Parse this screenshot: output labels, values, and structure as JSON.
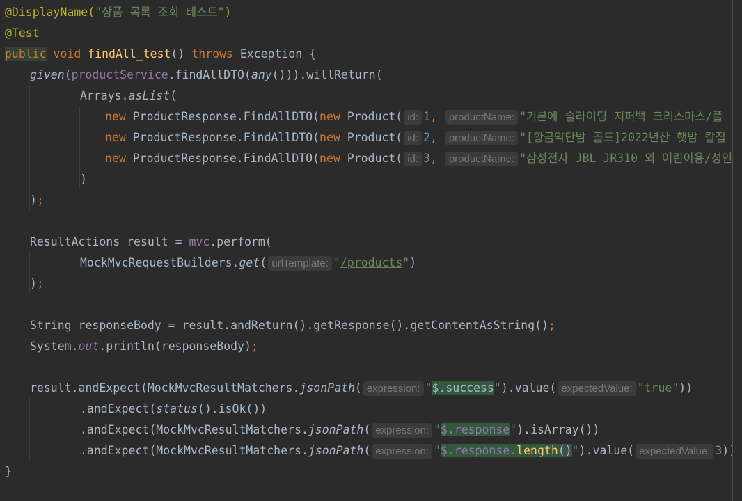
{
  "code": {
    "l1": {
      "annotation": "@DisplayName(",
      "string": "\"상품 목록 조회 테스트\"",
      "close": ")"
    },
    "l2": {
      "annotation": "@Test"
    },
    "l3": {
      "public": "public",
      "void": "void",
      "method": "findAll_test",
      "params": "()",
      "throws": "throws",
      "rest": "Exception {"
    },
    "l4": {
      "given": "given",
      "p1": "(",
      "service": "productService",
      "call": ".findAllDTO(",
      "any": "any",
      "rest": "())).willReturn("
    },
    "l5": {
      "text": "Arrays.",
      "aslist": "asList",
      "paren": "("
    },
    "rows": [
      {
        "new1": "new",
        "cls": " ProductResponse.FindAllDTO(",
        "new2": "new",
        "product": " Product(",
        "id_hint": "id:",
        "id": "1",
        "comma": ",",
        "name_hint": "productName:",
        "name": "\"기본에 슬라이딩 지퍼백 크리스마스/플"
      },
      {
        "new1": "new",
        "cls": " ProductResponse.FindAllDTO(",
        "new2": "new",
        "product": " Product(",
        "id_hint": "id:",
        "id": "2",
        "comma": ",",
        "name_hint": "productName:",
        "name": "\"[황금약단밤 골드]2022년산 햇밤 칼집"
      },
      {
        "new1": "new",
        "cls": " ProductResponse.FindAllDTO(",
        "new2": "new",
        "product": " Product(",
        "id_hint": "id:",
        "id": "3",
        "comma": ",",
        "name_hint": "productName:",
        "name": "\"삼성전자 JBL JR310 외 어린이용/성인"
      }
    ],
    "l9": {
      "text": ")"
    },
    "l10": {
      "paren": ")",
      "semi": ";"
    },
    "l12": {
      "text": "ResultActions result = ",
      "mvc": "mvc",
      "rest": ".perform("
    },
    "l13": {
      "text": "MockMvcRequestBuilders.",
      "get": "get",
      "paren": "(",
      "hint": "urlTemplate:",
      "q1": "\"",
      "url": "/products",
      "q2": "\"",
      "close": ")"
    },
    "l14": {
      "paren": ")",
      "semi": ";"
    },
    "l16": {
      "text": "String responseBody = result.andReturn().getResponse().getContentAsString()",
      "semi": ";"
    },
    "l17": {
      "text": "System.",
      "out": "out",
      "rest": ".println(responseBody)",
      "semi": ";"
    },
    "l19": {
      "text": "result.andExpect(MockMvcResultMatchers.",
      "jsonpath": "jsonPath",
      "paren": "(",
      "hint": "expression:",
      "q1": "\"",
      "value": "$.success",
      "q2": "\"",
      "mid": ").value(",
      "hint2": "expectedValue:",
      "val2": "\"true\"",
      "close": "))"
    },
    "l20": {
      "text": ".andExpect(",
      "status": "status",
      "rest": "().isOk())"
    },
    "l21": {
      "text": ".andExpect(MockMvcResultMatchers.",
      "jsonpath": "jsonPath",
      "paren": "(",
      "hint": "expression:",
      "q1": "\"",
      "value": "$.response",
      "q2": "\"",
      "rest": ").isArray())"
    },
    "l22": {
      "text": ".andExpect(MockMvcResultMatchers.",
      "jsonpath": "jsonPath",
      "paren": "(",
      "hint": "expression:",
      "q1": "\"",
      "value1": "$.response.",
      "length": "length",
      "brace": "()",
      "q2": "\"",
      "mid": ").value(",
      "hint2": "expectedValue:",
      "num": "3",
      "close": "))",
      "semi": ";"
    },
    "l23": {
      "text": "}"
    }
  },
  "colors": {
    "background": "#2b2b2b",
    "annotation": "#bbb529",
    "keyword": "#cc7832",
    "string": "#6a8759",
    "method": "#ffc66d",
    "number": "#6897bb",
    "field": "#9876aa",
    "default": "#a9b7c6",
    "hint": "#787878"
  }
}
